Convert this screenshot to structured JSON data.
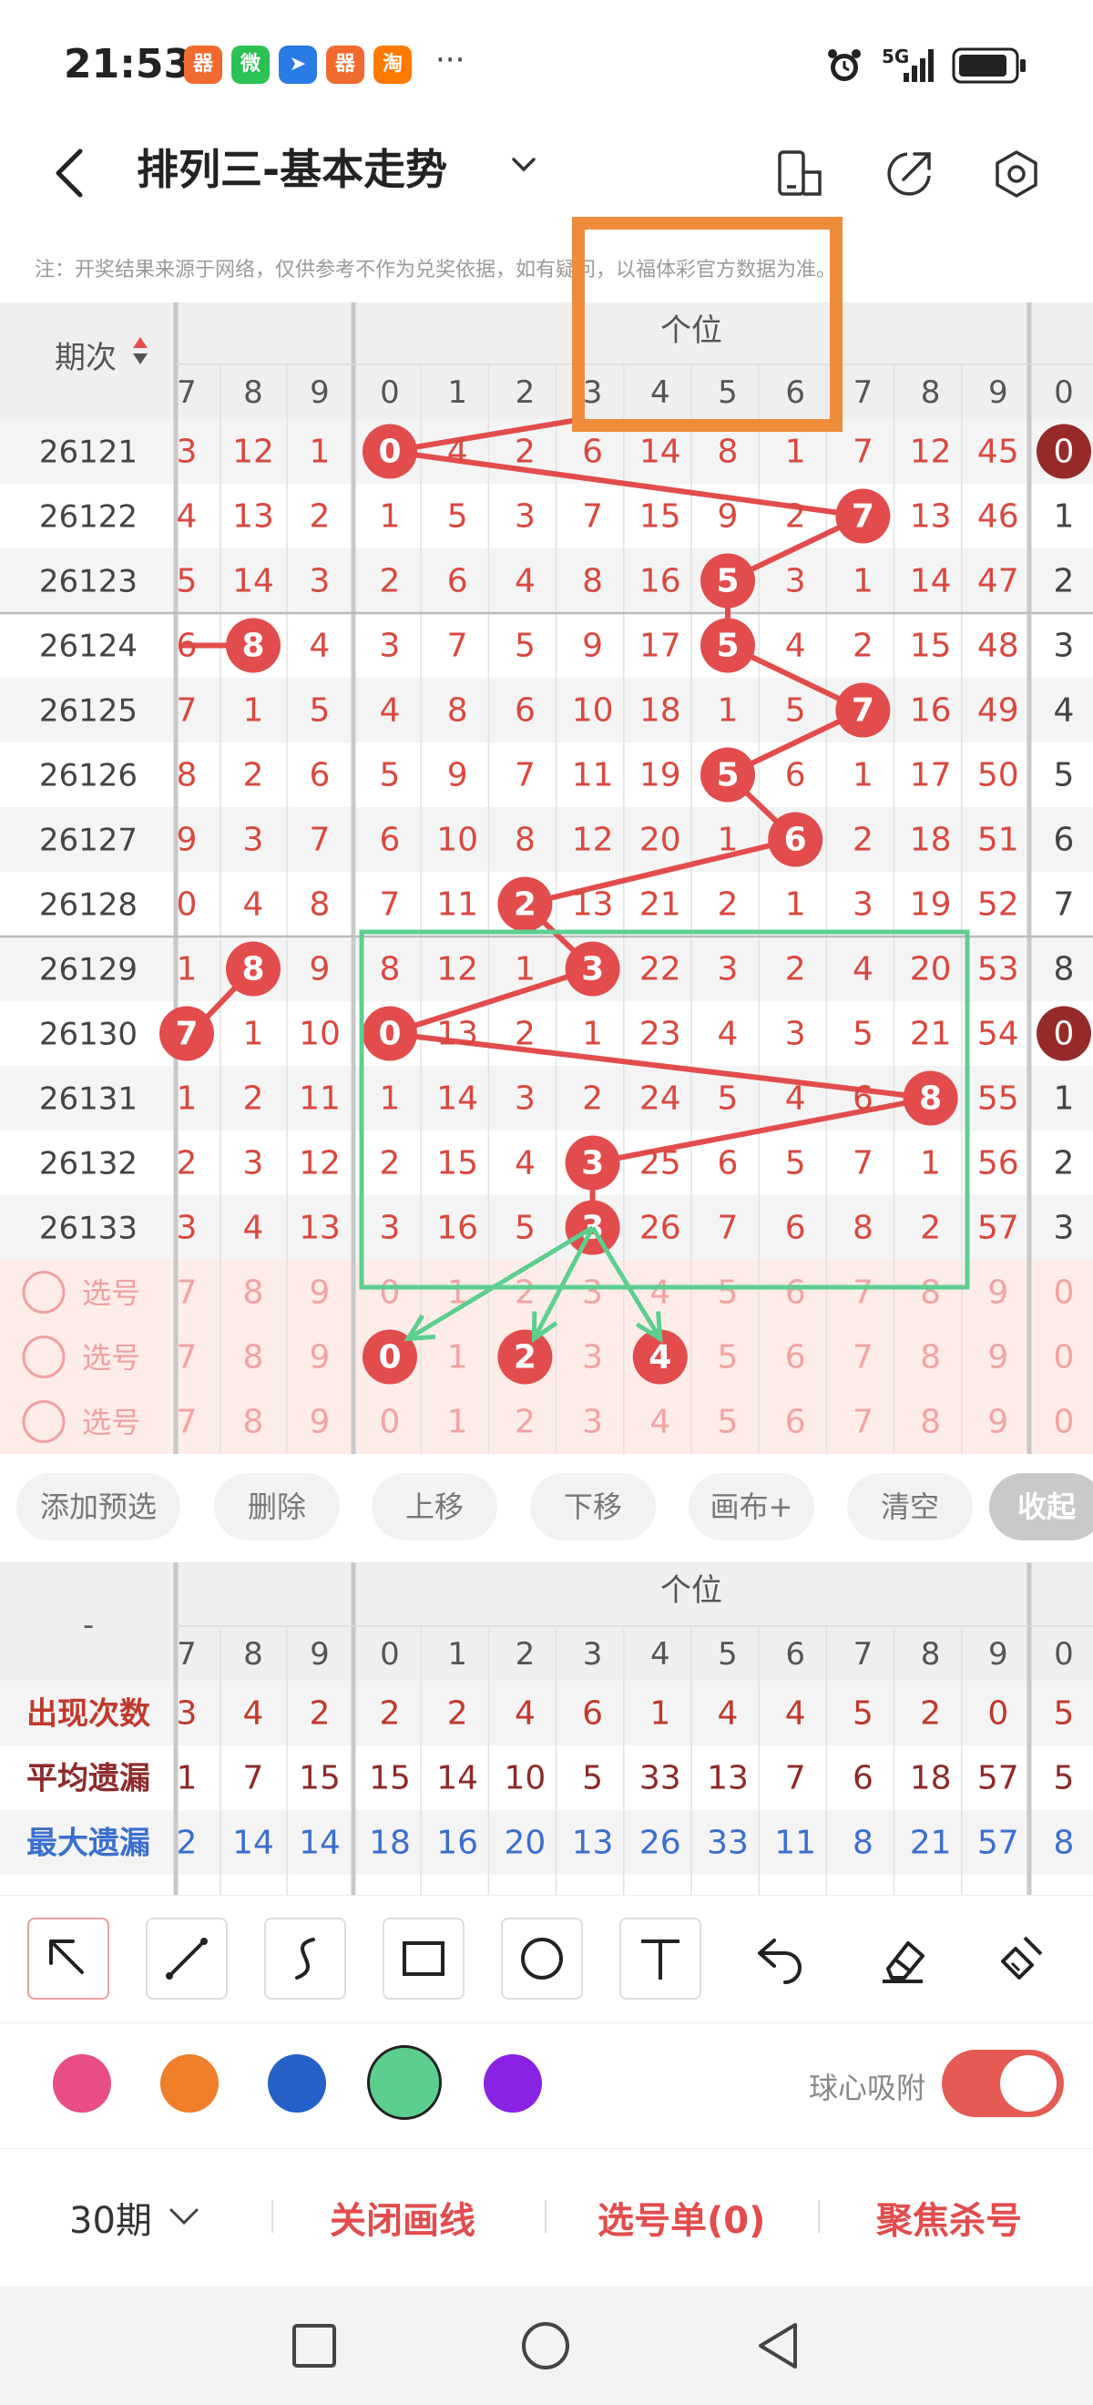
{
  "status": {
    "time": "21:53",
    "dots": "···",
    "network": "5G",
    "apps": [
      {
        "name": "app-icon-1",
        "glyph": "器",
        "color": "#f06a2f"
      },
      {
        "name": "wechat-icon",
        "glyph": "微",
        "color": "#2bc155"
      },
      {
        "name": "app-icon-3",
        "glyph": "➤",
        "color": "#2a7be4"
      },
      {
        "name": "app-icon-4",
        "glyph": "器",
        "color": "#f06a2f"
      },
      {
        "name": "taobao-icon",
        "glyph": "淘",
        "color": "#ff7a00"
      }
    ]
  },
  "header": {
    "title": "排列三-基本走势",
    "notice": "注：开奖结果来源于网络，仅供参考不作为兑奖依据，如有疑问，以福体彩官方数据为准。"
  },
  "grid": {
    "period_header": "期次",
    "section_label": "个位",
    "left_digits": [
      "7",
      "8",
      "9"
    ],
    "main_digits": [
      "0",
      "1",
      "2",
      "3",
      "4",
      "5",
      "6",
      "7",
      "8",
      "9"
    ],
    "right_digit": "0",
    "rows": [
      {
        "period": "26121",
        "left": [
          "3",
          "12",
          "1"
        ],
        "main": [
          "0",
          "4",
          "2",
          "6",
          "14",
          "8",
          "1",
          "7",
          "12",
          "45"
        ],
        "right": "0",
        "hit_left": -1,
        "hit_main": 0,
        "hit_right": true
      },
      {
        "period": "26122",
        "left": [
          "4",
          "13",
          "2"
        ],
        "main": [
          "1",
          "5",
          "3",
          "7",
          "15",
          "9",
          "2",
          "7",
          "13",
          "46"
        ],
        "right": "1",
        "hit_left": -1,
        "hit_main": 7,
        "hit_right": false
      },
      {
        "period": "26123",
        "left": [
          "5",
          "14",
          "3"
        ],
        "main": [
          "2",
          "6",
          "4",
          "8",
          "16",
          "5",
          "3",
          "1",
          "14",
          "47"
        ],
        "right": "2",
        "hit_left": -1,
        "hit_main": 5,
        "hit_right": false
      },
      {
        "period": "26124",
        "left": [
          "6",
          "8",
          "4"
        ],
        "main": [
          "3",
          "7",
          "5",
          "9",
          "17",
          "5",
          "4",
          "2",
          "15",
          "48"
        ],
        "right": "3",
        "hit_left": 1,
        "hit_main": 5,
        "hit_right": false
      },
      {
        "period": "26125",
        "left": [
          "7",
          "1",
          "5"
        ],
        "main": [
          "4",
          "8",
          "6",
          "10",
          "18",
          "1",
          "5",
          "7",
          "16",
          "49"
        ],
        "right": "4",
        "hit_left": -1,
        "hit_main": 7,
        "hit_right": false
      },
      {
        "period": "26126",
        "left": [
          "8",
          "2",
          "6"
        ],
        "main": [
          "5",
          "9",
          "7",
          "11",
          "19",
          "5",
          "6",
          "1",
          "17",
          "50"
        ],
        "right": "5",
        "hit_left": -1,
        "hit_main": 5,
        "hit_right": false
      },
      {
        "period": "26127",
        "left": [
          "9",
          "3",
          "7"
        ],
        "main": [
          "6",
          "10",
          "8",
          "12",
          "20",
          "1",
          "6",
          "2",
          "18",
          "51"
        ],
        "right": "6",
        "hit_left": -1,
        "hit_main": 6,
        "hit_right": false
      },
      {
        "period": "26128",
        "left": [
          "0",
          "4",
          "8"
        ],
        "main": [
          "7",
          "11",
          "2",
          "13",
          "21",
          "2",
          "1",
          "3",
          "19",
          "52"
        ],
        "right": "7",
        "hit_left": -1,
        "hit_main": 2,
        "hit_right": false
      },
      {
        "period": "26129",
        "left": [
          "1",
          "8",
          "9"
        ],
        "main": [
          "8",
          "12",
          "1",
          "3",
          "22",
          "3",
          "2",
          "4",
          "20",
          "53"
        ],
        "right": "8",
        "hit_left": 1,
        "hit_main": 3,
        "hit_right": false
      },
      {
        "period": "26130",
        "left": [
          "7",
          "1",
          "10"
        ],
        "main": [
          "0",
          "13",
          "2",
          "1",
          "23",
          "4",
          "3",
          "5",
          "21",
          "54"
        ],
        "right": "0",
        "hit_left": 0,
        "hit_main": 0,
        "hit_right": true
      },
      {
        "period": "26131",
        "left": [
          "1",
          "2",
          "11"
        ],
        "main": [
          "1",
          "14",
          "3",
          "2",
          "24",
          "5",
          "4",
          "6",
          "8",
          "55"
        ],
        "right": "1",
        "hit_left": -1,
        "hit_main": 8,
        "hit_right": false
      },
      {
        "period": "26132",
        "left": [
          "2",
          "3",
          "12"
        ],
        "main": [
          "2",
          "15",
          "4",
          "3",
          "25",
          "6",
          "5",
          "7",
          "1",
          "56"
        ],
        "right": "2",
        "hit_left": -1,
        "hit_main": 3,
        "hit_right": false
      },
      {
        "period": "26133",
        "left": [
          "3",
          "4",
          "13"
        ],
        "main": [
          "3",
          "16",
          "5",
          "3",
          "26",
          "7",
          "6",
          "8",
          "2",
          "57"
        ],
        "right": "3",
        "hit_left": -1,
        "hit_main": 3,
        "hit_right": false
      }
    ],
    "select_label": "选号",
    "select_rows": [
      {
        "left": [
          "7",
          "8",
          "9"
        ],
        "main": [
          "0",
          "1",
          "2",
          "3",
          "4",
          "5",
          "6",
          "7",
          "8",
          "9"
        ],
        "right": "0",
        "picked": []
      },
      {
        "left": [
          "7",
          "8",
          "9"
        ],
        "main": [
          "0",
          "1",
          "2",
          "3",
          "4",
          "5",
          "6",
          "7",
          "8",
          "9"
        ],
        "right": "0",
        "picked": [
          0,
          2,
          4
        ]
      },
      {
        "left": [
          "7",
          "8",
          "9"
        ],
        "main": [
          "0",
          "1",
          "2",
          "3",
          "4",
          "5",
          "6",
          "7",
          "8",
          "9"
        ],
        "right": "0",
        "picked": []
      }
    ]
  },
  "buttons": [
    "添加预选",
    "删除",
    "上移",
    "下移",
    "画布+",
    "清空",
    "收起"
  ],
  "stats": {
    "corner": "-",
    "section_label": "个位",
    "left_digits": [
      "7",
      "8",
      "9"
    ],
    "main_digits": [
      "0",
      "1",
      "2",
      "3",
      "4",
      "5",
      "6",
      "7",
      "8",
      "9"
    ],
    "right_digit": "0",
    "rows": [
      {
        "label": "出现次数",
        "color": "#c0392b",
        "left": [
          "3",
          "4",
          "2"
        ],
        "main": [
          "2",
          "2",
          "4",
          "6",
          "1",
          "4",
          "4",
          "5",
          "2",
          "0"
        ],
        "right": "5"
      },
      {
        "label": "平均遗漏",
        "color": "#8e2a2a",
        "left": [
          "1",
          "7",
          "15"
        ],
        "main": [
          "15",
          "14",
          "10",
          "5",
          "33",
          "13",
          "7",
          "6",
          "18",
          "57"
        ],
        "right": "5"
      },
      {
        "label": "最大遗漏",
        "color": "#3a6fcf",
        "left": [
          "2",
          "14",
          "14"
        ],
        "main": [
          "18",
          "16",
          "20",
          "13",
          "26",
          "33",
          "11",
          "8",
          "21",
          "57"
        ],
        "right": "8"
      }
    ]
  },
  "snap_label": "球心吸附",
  "period_select": "30期",
  "bottom_actions": [
    "关闭画线",
    "选号单(0)",
    "聚焦杀号"
  ],
  "palette": [
    "#e84d86",
    "#ef7f2b",
    "#2460c8",
    "#5ccf8f",
    "#8a22e3"
  ],
  "colors": {
    "accent": "#e24c4c",
    "dark_ball": "#962a2a",
    "green_line": "#5ccf8f",
    "orange_box": "#ee8c3c"
  }
}
